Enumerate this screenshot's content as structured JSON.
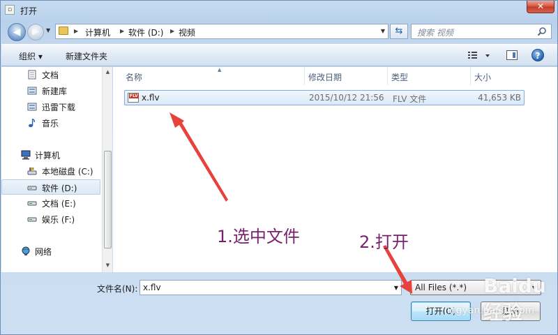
{
  "window": {
    "title": "打开",
    "close_label": "✕"
  },
  "address": {
    "segments": [
      "计算机",
      "软件 (D:)",
      "视频"
    ],
    "search_placeholder": "搜索 视频"
  },
  "toolbar": {
    "organize_label": "组织 ▾",
    "new_folder_label": "新建文件夹"
  },
  "nav": {
    "items": [
      {
        "label": "文档",
        "icon": "document-library-icon"
      },
      {
        "label": "新建库",
        "icon": "library-icon"
      },
      {
        "label": "迅雷下载",
        "icon": "download-library-icon"
      },
      {
        "label": "音乐",
        "icon": "music-icon"
      },
      {
        "label": "计算机",
        "icon": "computer-icon"
      },
      {
        "label": "本地磁盘 (C:)",
        "icon": "system-drive-icon"
      },
      {
        "label": "软件 (D:)",
        "icon": "drive-icon",
        "selected": true
      },
      {
        "label": "文档 (E:)",
        "icon": "drive-icon"
      },
      {
        "label": "娱乐 (F:)",
        "icon": "drive-icon"
      },
      {
        "label": "网络",
        "icon": "network-icon"
      }
    ]
  },
  "columns": [
    "名称",
    "修改日期",
    "类型",
    "大小"
  ],
  "files": [
    {
      "name": "x.flv",
      "modified": "2015/10/12 21:56",
      "type": "FLV 文件",
      "size": "41,653 KB"
    }
  ],
  "annotations": {
    "step1": "1.选中文件",
    "step2": "2.打开",
    "color": "#7a1f6e",
    "arrow_color": "#e8423c"
  },
  "footer": {
    "filename_label": "文件名(N):",
    "filename_value": "x.flv",
    "filter_value": "All Files (*.*)",
    "open_label": "打开(O)",
    "cancel_label": "取消"
  },
  "watermark": {
    "main": "Baidu经验",
    "sub": "jingyan.baidu.com"
  }
}
